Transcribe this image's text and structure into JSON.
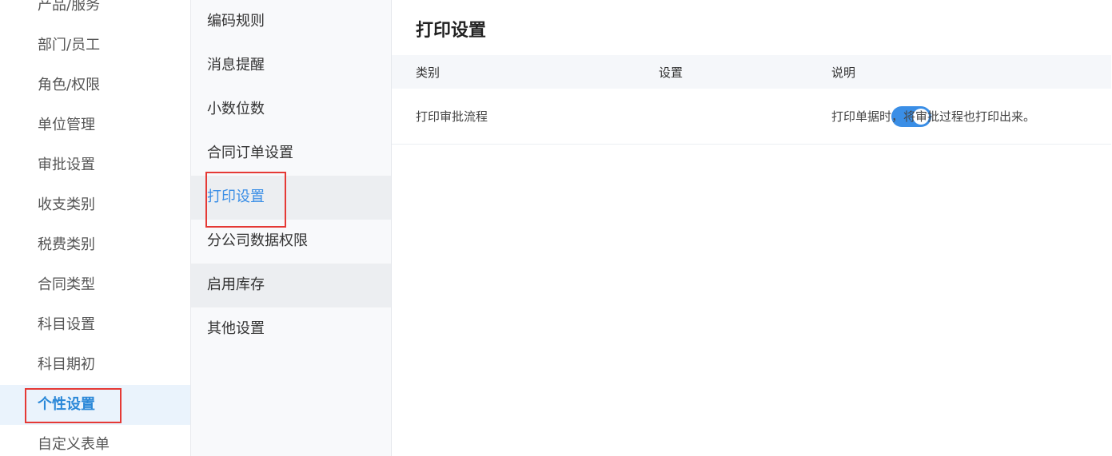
{
  "sidebar": {
    "items": [
      {
        "label": "产品/服务",
        "active": false
      },
      {
        "label": "部门/员工",
        "active": false
      },
      {
        "label": "角色/权限",
        "active": false
      },
      {
        "label": "单位管理",
        "active": false
      },
      {
        "label": "审批设置",
        "active": false
      },
      {
        "label": "收支类别",
        "active": false
      },
      {
        "label": "税费类别",
        "active": false
      },
      {
        "label": "合同类型",
        "active": false
      },
      {
        "label": "科目设置",
        "active": false
      },
      {
        "label": "科目期初",
        "active": false
      },
      {
        "label": "个性设置",
        "active": true
      },
      {
        "label": "自定义表单",
        "active": false
      }
    ]
  },
  "submenu": {
    "items": [
      {
        "label": "编码规则"
      },
      {
        "label": "消息提醒"
      },
      {
        "label": "小数位数"
      },
      {
        "label": "合同订单设置"
      },
      {
        "label": "打印设置"
      },
      {
        "label": "分公司数据权限"
      },
      {
        "label": "启用库存"
      },
      {
        "label": "其他设置"
      }
    ]
  },
  "main": {
    "title": "打印设置",
    "table": {
      "headers": [
        "类别",
        "设置",
        "说明"
      ],
      "rows": [
        {
          "category": "打印审批流程",
          "enabled": true,
          "description": "打印单据时，将审批过程也打印出来。"
        }
      ]
    }
  },
  "colors": {
    "accent": "#3a8ee6",
    "highlight_box": "#e53935"
  }
}
